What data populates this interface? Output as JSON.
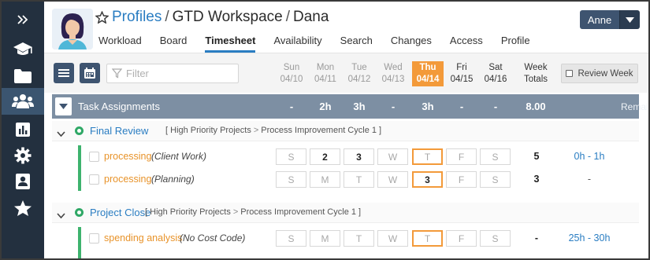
{
  "sidebar": {
    "items": [
      {
        "icon": "collapse-chevrons-icon"
      },
      {
        "icon": "graduation-cap-icon"
      },
      {
        "icon": "folder-icon"
      },
      {
        "icon": "users-icon"
      },
      {
        "icon": "bar-chart-icon"
      },
      {
        "icon": "gear-icon"
      },
      {
        "icon": "contact-card-icon"
      },
      {
        "icon": "star-icon"
      }
    ]
  },
  "header": {
    "breadcrumb": [
      {
        "label": "Profiles"
      },
      {
        "label": "GTD Workspace"
      },
      {
        "label": "Dana"
      }
    ],
    "separator": "/",
    "tabs": [
      {
        "label": "Workload"
      },
      {
        "label": "Board"
      },
      {
        "label": "Timesheet"
      },
      {
        "label": "Availability"
      },
      {
        "label": "Search"
      },
      {
        "label": "Changes"
      },
      {
        "label": "Access"
      },
      {
        "label": "Profile"
      }
    ],
    "active_tab": "Timesheet",
    "user_label": "Anne"
  },
  "toolbar": {
    "filter_placeholder": "Filter",
    "days": [
      {
        "name": "Sun",
        "date": "04/10"
      },
      {
        "name": "Mon",
        "date": "04/11"
      },
      {
        "name": "Tue",
        "date": "04/12"
      },
      {
        "name": "Wed",
        "date": "04/13"
      },
      {
        "name": "Thu",
        "date": "04/14"
      },
      {
        "name": "Fri",
        "date": "04/15"
      },
      {
        "name": "Sat",
        "date": "04/16"
      }
    ],
    "week_totals_line1": "Week",
    "week_totals_line2": "Totals",
    "review_week_label": "Review Week"
  },
  "assignments": {
    "title": "Task Assignments",
    "day_totals": [
      "-",
      "2h",
      "3h",
      "-",
      "3h",
      "-",
      "-"
    ],
    "week_total": "8.00",
    "remaining_label": "Remaining"
  },
  "groups": [
    {
      "name": "Final Review",
      "path_open": "[",
      "path_parent": "High Priority Projects",
      "path_child": "Process Improvement Cycle 1",
      "path_close": "]",
      "tasks": [
        {
          "name": "processing",
          "code": "(Client Work)",
          "cells": [
            "S",
            "2",
            "3",
            "W",
            "T",
            "F",
            "S"
          ],
          "total": "5",
          "remaining": "0h - 1h"
        },
        {
          "name": "processing",
          "code": "(Planning)",
          "cells": [
            "S",
            "M",
            "T",
            "W",
            "3",
            "F",
            "S"
          ],
          "total": "3",
          "remaining": "-"
        }
      ]
    },
    {
      "name": "Project Close",
      "path_open": "[",
      "path_parent": "High Priority Projects",
      "path_child": "Process Improvement Cycle 1",
      "path_close": "]",
      "tasks": [
        {
          "name": "spending analysis",
          "code": "(No Cost Code)",
          "cells": [
            "S",
            "M",
            "T",
            "W",
            "T",
            "F",
            "S"
          ],
          "total": "-",
          "remaining": "25h - 30h"
        }
      ]
    }
  ],
  "colors": {
    "sidebar": "#23303f",
    "accent_blue": "#2a7dc2",
    "today_orange": "#f39a3a",
    "group_green": "#2fa866",
    "header_bar": "#7d8fa3"
  }
}
